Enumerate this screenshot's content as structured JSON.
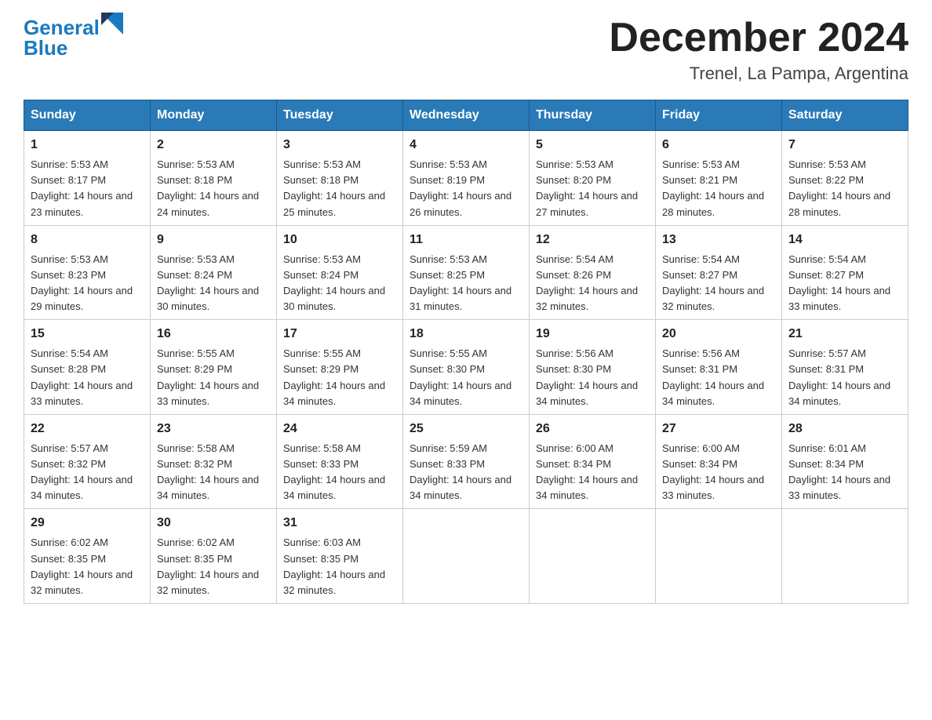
{
  "header": {
    "logo_text_main": "General",
    "logo_text_blue": "Blue",
    "month_year": "December 2024",
    "location": "Trenel, La Pampa, Argentina"
  },
  "days_of_week": [
    "Sunday",
    "Monday",
    "Tuesday",
    "Wednesday",
    "Thursday",
    "Friday",
    "Saturday"
  ],
  "weeks": [
    [
      {
        "num": "1",
        "sunrise": "Sunrise: 5:53 AM",
        "sunset": "Sunset: 8:17 PM",
        "daylight": "Daylight: 14 hours and 23 minutes."
      },
      {
        "num": "2",
        "sunrise": "Sunrise: 5:53 AM",
        "sunset": "Sunset: 8:18 PM",
        "daylight": "Daylight: 14 hours and 24 minutes."
      },
      {
        "num": "3",
        "sunrise": "Sunrise: 5:53 AM",
        "sunset": "Sunset: 8:18 PM",
        "daylight": "Daylight: 14 hours and 25 minutes."
      },
      {
        "num": "4",
        "sunrise": "Sunrise: 5:53 AM",
        "sunset": "Sunset: 8:19 PM",
        "daylight": "Daylight: 14 hours and 26 minutes."
      },
      {
        "num": "5",
        "sunrise": "Sunrise: 5:53 AM",
        "sunset": "Sunset: 8:20 PM",
        "daylight": "Daylight: 14 hours and 27 minutes."
      },
      {
        "num": "6",
        "sunrise": "Sunrise: 5:53 AM",
        "sunset": "Sunset: 8:21 PM",
        "daylight": "Daylight: 14 hours and 28 minutes."
      },
      {
        "num": "7",
        "sunrise": "Sunrise: 5:53 AM",
        "sunset": "Sunset: 8:22 PM",
        "daylight": "Daylight: 14 hours and 28 minutes."
      }
    ],
    [
      {
        "num": "8",
        "sunrise": "Sunrise: 5:53 AM",
        "sunset": "Sunset: 8:23 PM",
        "daylight": "Daylight: 14 hours and 29 minutes."
      },
      {
        "num": "9",
        "sunrise": "Sunrise: 5:53 AM",
        "sunset": "Sunset: 8:24 PM",
        "daylight": "Daylight: 14 hours and 30 minutes."
      },
      {
        "num": "10",
        "sunrise": "Sunrise: 5:53 AM",
        "sunset": "Sunset: 8:24 PM",
        "daylight": "Daylight: 14 hours and 30 minutes."
      },
      {
        "num": "11",
        "sunrise": "Sunrise: 5:53 AM",
        "sunset": "Sunset: 8:25 PM",
        "daylight": "Daylight: 14 hours and 31 minutes."
      },
      {
        "num": "12",
        "sunrise": "Sunrise: 5:54 AM",
        "sunset": "Sunset: 8:26 PM",
        "daylight": "Daylight: 14 hours and 32 minutes."
      },
      {
        "num": "13",
        "sunrise": "Sunrise: 5:54 AM",
        "sunset": "Sunset: 8:27 PM",
        "daylight": "Daylight: 14 hours and 32 minutes."
      },
      {
        "num": "14",
        "sunrise": "Sunrise: 5:54 AM",
        "sunset": "Sunset: 8:27 PM",
        "daylight": "Daylight: 14 hours and 33 minutes."
      }
    ],
    [
      {
        "num": "15",
        "sunrise": "Sunrise: 5:54 AM",
        "sunset": "Sunset: 8:28 PM",
        "daylight": "Daylight: 14 hours and 33 minutes."
      },
      {
        "num": "16",
        "sunrise": "Sunrise: 5:55 AM",
        "sunset": "Sunset: 8:29 PM",
        "daylight": "Daylight: 14 hours and 33 minutes."
      },
      {
        "num": "17",
        "sunrise": "Sunrise: 5:55 AM",
        "sunset": "Sunset: 8:29 PM",
        "daylight": "Daylight: 14 hours and 34 minutes."
      },
      {
        "num": "18",
        "sunrise": "Sunrise: 5:55 AM",
        "sunset": "Sunset: 8:30 PM",
        "daylight": "Daylight: 14 hours and 34 minutes."
      },
      {
        "num": "19",
        "sunrise": "Sunrise: 5:56 AM",
        "sunset": "Sunset: 8:30 PM",
        "daylight": "Daylight: 14 hours and 34 minutes."
      },
      {
        "num": "20",
        "sunrise": "Sunrise: 5:56 AM",
        "sunset": "Sunset: 8:31 PM",
        "daylight": "Daylight: 14 hours and 34 minutes."
      },
      {
        "num": "21",
        "sunrise": "Sunrise: 5:57 AM",
        "sunset": "Sunset: 8:31 PM",
        "daylight": "Daylight: 14 hours and 34 minutes."
      }
    ],
    [
      {
        "num": "22",
        "sunrise": "Sunrise: 5:57 AM",
        "sunset": "Sunset: 8:32 PM",
        "daylight": "Daylight: 14 hours and 34 minutes."
      },
      {
        "num": "23",
        "sunrise": "Sunrise: 5:58 AM",
        "sunset": "Sunset: 8:32 PM",
        "daylight": "Daylight: 14 hours and 34 minutes."
      },
      {
        "num": "24",
        "sunrise": "Sunrise: 5:58 AM",
        "sunset": "Sunset: 8:33 PM",
        "daylight": "Daylight: 14 hours and 34 minutes."
      },
      {
        "num": "25",
        "sunrise": "Sunrise: 5:59 AM",
        "sunset": "Sunset: 8:33 PM",
        "daylight": "Daylight: 14 hours and 34 minutes."
      },
      {
        "num": "26",
        "sunrise": "Sunrise: 6:00 AM",
        "sunset": "Sunset: 8:34 PM",
        "daylight": "Daylight: 14 hours and 34 minutes."
      },
      {
        "num": "27",
        "sunrise": "Sunrise: 6:00 AM",
        "sunset": "Sunset: 8:34 PM",
        "daylight": "Daylight: 14 hours and 33 minutes."
      },
      {
        "num": "28",
        "sunrise": "Sunrise: 6:01 AM",
        "sunset": "Sunset: 8:34 PM",
        "daylight": "Daylight: 14 hours and 33 minutes."
      }
    ],
    [
      {
        "num": "29",
        "sunrise": "Sunrise: 6:02 AM",
        "sunset": "Sunset: 8:35 PM",
        "daylight": "Daylight: 14 hours and 32 minutes."
      },
      {
        "num": "30",
        "sunrise": "Sunrise: 6:02 AM",
        "sunset": "Sunset: 8:35 PM",
        "daylight": "Daylight: 14 hours and 32 minutes."
      },
      {
        "num": "31",
        "sunrise": "Sunrise: 6:03 AM",
        "sunset": "Sunset: 8:35 PM",
        "daylight": "Daylight: 14 hours and 32 minutes."
      },
      null,
      null,
      null,
      null
    ]
  ]
}
